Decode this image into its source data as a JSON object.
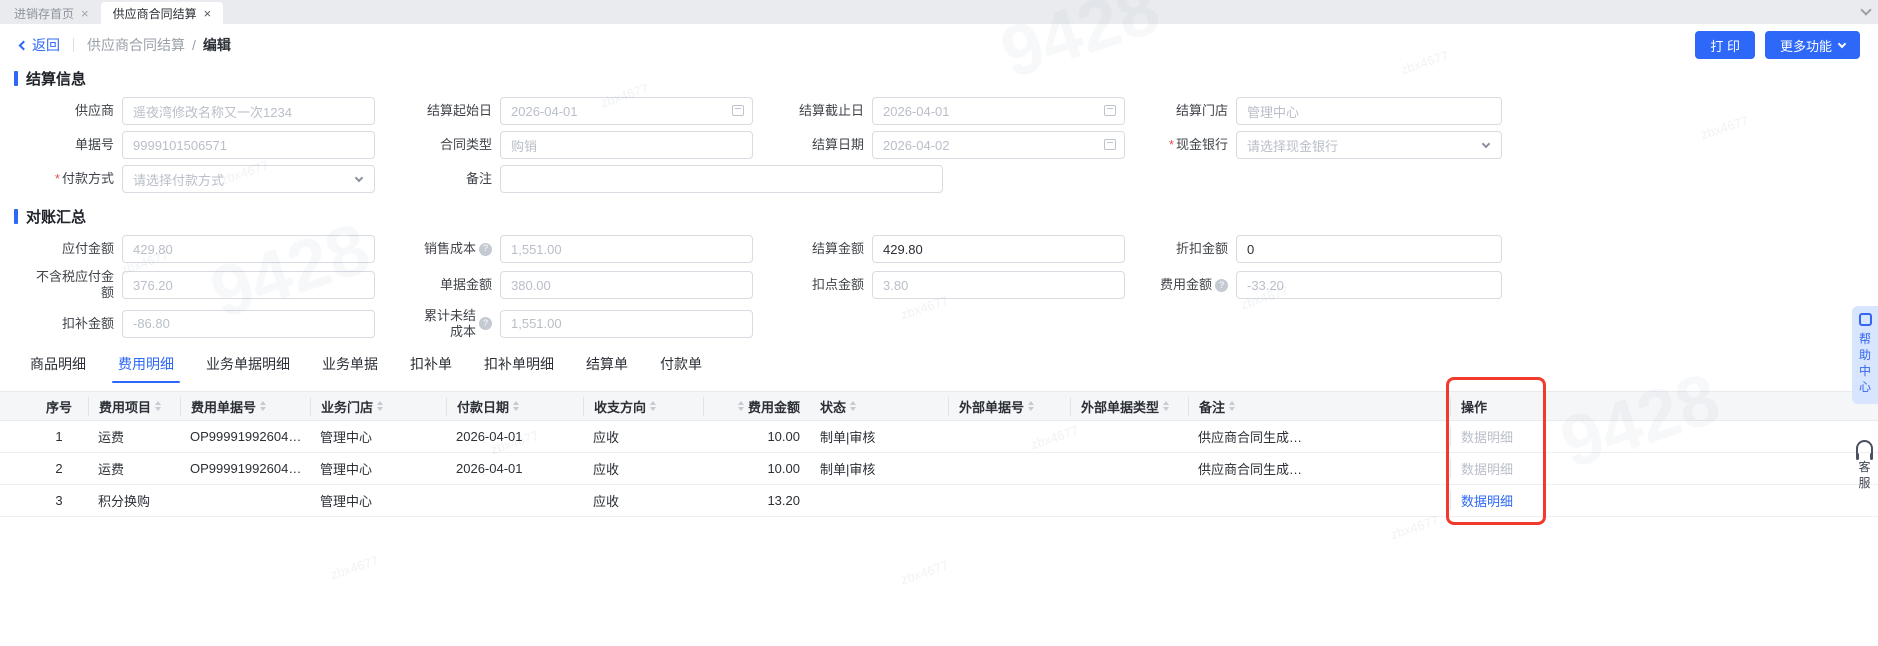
{
  "window": {
    "tabs": [
      {
        "label": "进销存首页",
        "close": "×"
      },
      {
        "label": "供应商合同结算",
        "close": "×"
      }
    ]
  },
  "toolbar": {
    "back": "返回",
    "crumb_parent": "供应商合同结算",
    "crumb_sep": "/",
    "crumb_current": "编辑",
    "print": "打 印",
    "more": "更多功能"
  },
  "settlement": {
    "title": "结算信息",
    "supplier": {
      "label": "供应商",
      "value": "遥夜湾修改名称又一次1234"
    },
    "start_date": {
      "label": "结算起始日",
      "value": "2026-04-01"
    },
    "end_date": {
      "label": "结算截止日",
      "value": "2026-04-01"
    },
    "store": {
      "label": "结算门店",
      "value": "管理中心"
    },
    "doc_no": {
      "label": "单据号",
      "value": "9999101506571"
    },
    "contract_type": {
      "label": "合同类型",
      "value": "购销"
    },
    "settle_date": {
      "label": "结算日期",
      "value": "2026-04-02"
    },
    "cash_bank": {
      "label": "现金银行",
      "placeholder": "请选择现金银行"
    },
    "pay_method": {
      "label": "付款方式",
      "placeholder": "请选择付款方式"
    },
    "remark": {
      "label": "备注",
      "value": ""
    }
  },
  "summary": {
    "title": "对账汇总",
    "payable": {
      "label": "应付金额",
      "value": "429.80"
    },
    "sales_cost": {
      "label": "销售成本",
      "value": "1,551.00"
    },
    "settle_amount": {
      "label": "结算金额",
      "value": "429.80"
    },
    "discount": {
      "label": "折扣金额",
      "value": "0"
    },
    "payable_excl_tax": {
      "label": "不含税应付金额",
      "value": "376.20"
    },
    "doc_amount": {
      "label": "单据金额",
      "value": "380.00"
    },
    "deduct_point": {
      "label": "扣点金额",
      "value": "3.80"
    },
    "fee_amount": {
      "label": "费用金额",
      "value": "-33.20"
    },
    "adjust_amount": {
      "label": "扣补金额",
      "value": "-86.80"
    },
    "unsettled_cost": {
      "label": "累计未结成本",
      "value": "1,551.00"
    }
  },
  "detail_tabs": [
    "商品明细",
    "费用明细",
    "业务单据明细",
    "业务单据",
    "扣补单",
    "扣补单明细",
    "结算单",
    "付款单"
  ],
  "table": {
    "columns": [
      "序号",
      "费用项目",
      "费用单据号",
      "业务门店",
      "付款日期",
      "收支方向",
      "费用金额",
      "状态",
      "外部单据号",
      "外部单据类型",
      "备注",
      "操作"
    ],
    "rows": [
      {
        "cells": [
          "1",
          "运费",
          "OP99991992604…",
          "管理中心",
          "2026-04-01",
          "应收",
          "10.00",
          "制单|审核",
          "",
          "",
          "供应商合同生成…"
        ],
        "action": "数据明细",
        "action_variant": "muted"
      },
      {
        "cells": [
          "2",
          "运费",
          "OP99991992604…",
          "管理中心",
          "2026-04-01",
          "应收",
          "10.00",
          "制单|审核",
          "",
          "",
          "供应商合同生成…"
        ],
        "action": "数据明细",
        "action_variant": "muted"
      },
      {
        "cells": [
          "3",
          "积分换购",
          "",
          "管理中心",
          "",
          "应收",
          "13.20",
          "",
          "",
          "",
          ""
        ],
        "action": "数据明细",
        "action_variant": "link"
      }
    ]
  },
  "side": {
    "help": "帮助中心",
    "service": "客服"
  },
  "watermark": "zbx4677",
  "watermark_big": "9428",
  "colors": {
    "primary": "#2d68f8",
    "highlight": "#f23a2c",
    "muted": "#b9bec8"
  }
}
